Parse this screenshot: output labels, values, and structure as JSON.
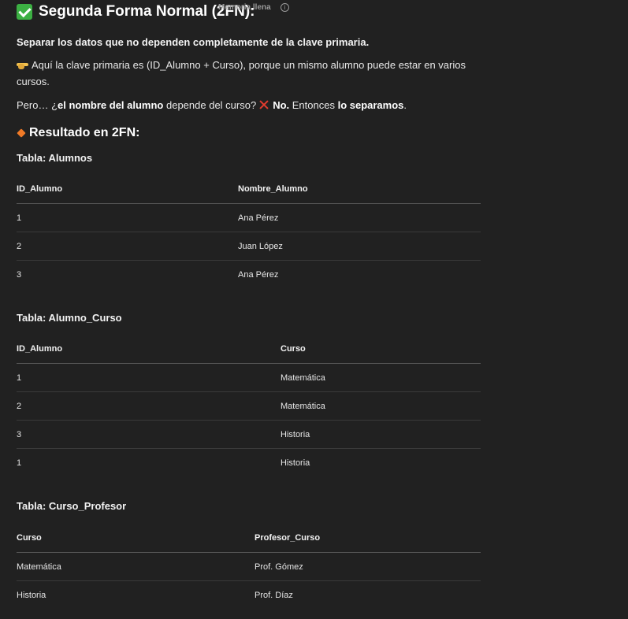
{
  "header": {
    "title": "Segunda Forma Normal (2FN):",
    "memory_badge": "Memoria llena",
    "info_glyph": "i"
  },
  "intro": {
    "p1": "Separar los datos que no dependen completamente de la clave primaria.",
    "p2": "Aquí la clave primaria es (ID_Alumno + Curso), porque un mismo alumno puede estar en varios cursos.",
    "p3_a": "Pero… ¿",
    "p3_b": "el nombre del alumno",
    "p3_c": " depende del curso?",
    "p3_d": "No.",
    "p3_e": " Entonces ",
    "p3_f": "lo separamos",
    "p3_g": "."
  },
  "result": {
    "title": "Resultado en 2FN:"
  },
  "tables": [
    {
      "title": "Tabla: Alumnos",
      "headers": [
        "ID_Alumno",
        "Nombre_Alumno"
      ],
      "rows": [
        [
          "1",
          "Ana Pérez"
        ],
        [
          "2",
          "Juan López"
        ],
        [
          "3",
          "Ana Pérez"
        ]
      ]
    },
    {
      "title": "Tabla: Alumno_Curso",
      "headers": [
        "ID_Alumno",
        "Curso"
      ],
      "rows": [
        [
          "1",
          "Matemática"
        ],
        [
          "2",
          "Matemática"
        ],
        [
          "3",
          "Historia"
        ],
        [
          "1",
          "Historia"
        ]
      ]
    },
    {
      "title": "Tabla: Curso_Profesor",
      "headers": [
        "Curso",
        "Profesor_Curso"
      ],
      "rows": [
        [
          "Matemática",
          "Prof. Gómez"
        ],
        [
          "Historia",
          "Prof. Díaz"
        ]
      ]
    }
  ],
  "icons": {
    "title_icon": "check-mark-icon",
    "pointer_icon": "pointing-hand-icon",
    "no_icon": "cross-mark-icon",
    "result_icon": "orange-diamond-icon",
    "info_icon": "info-icon"
  },
  "colors": {
    "background": "#212121",
    "check": "#3cb043",
    "cross": "#e23b2e",
    "diamond": "#f07a27"
  }
}
